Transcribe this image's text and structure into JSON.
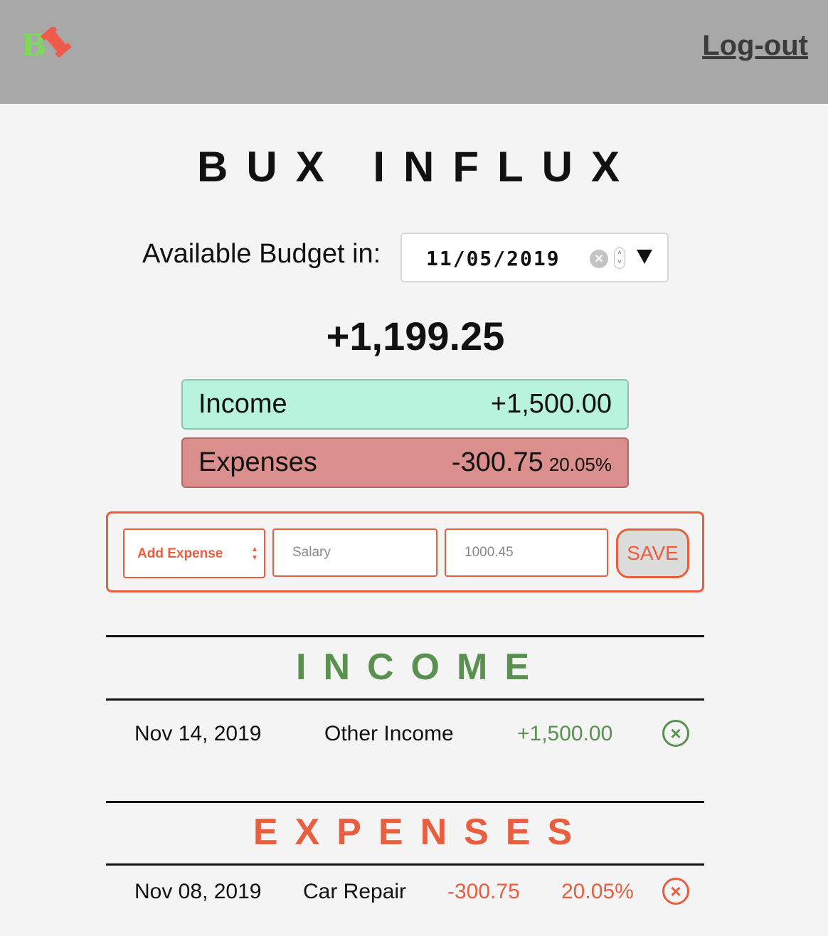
{
  "header": {
    "logo_alt": "BI",
    "logout_label": "Log-out"
  },
  "app": {
    "title": "BUX INFLUX",
    "budget_label": "Available Budget in:",
    "date_value": "11/05/2019",
    "budget_total": "+1,199.25"
  },
  "summary": {
    "income_label": "Income",
    "income_value": "+1,500.00",
    "expenses_label": "Expenses",
    "expenses_value": "-300.75",
    "expenses_percent": "20.05%"
  },
  "form": {
    "type_selected": "Add Expense",
    "description_placeholder": "Salary",
    "amount_placeholder": "1000.45",
    "save_label": "SAVE"
  },
  "income_section": {
    "title": "INCOME",
    "items": [
      {
        "date": "Nov 14, 2019",
        "description": "Other Income",
        "amount": "+1,500.00"
      }
    ]
  },
  "expenses_section": {
    "title": "EXPENSES",
    "items": [
      {
        "date": "Nov 08, 2019",
        "description": "Car Repair",
        "amount": "-300.75",
        "percent": "20.05%"
      }
    ]
  },
  "colors": {
    "accent": "#e85e3f",
    "income_green": "#5a9150",
    "income_bg": "#b8f4dd",
    "expense_bg": "#db8f8d",
    "header_bg": "#a8a8a8"
  },
  "icons": {
    "clear": "x-circle-icon",
    "spinner": "stepper-icon",
    "dropdown": "triangle-down-icon",
    "delete": "x-circle-icon"
  }
}
